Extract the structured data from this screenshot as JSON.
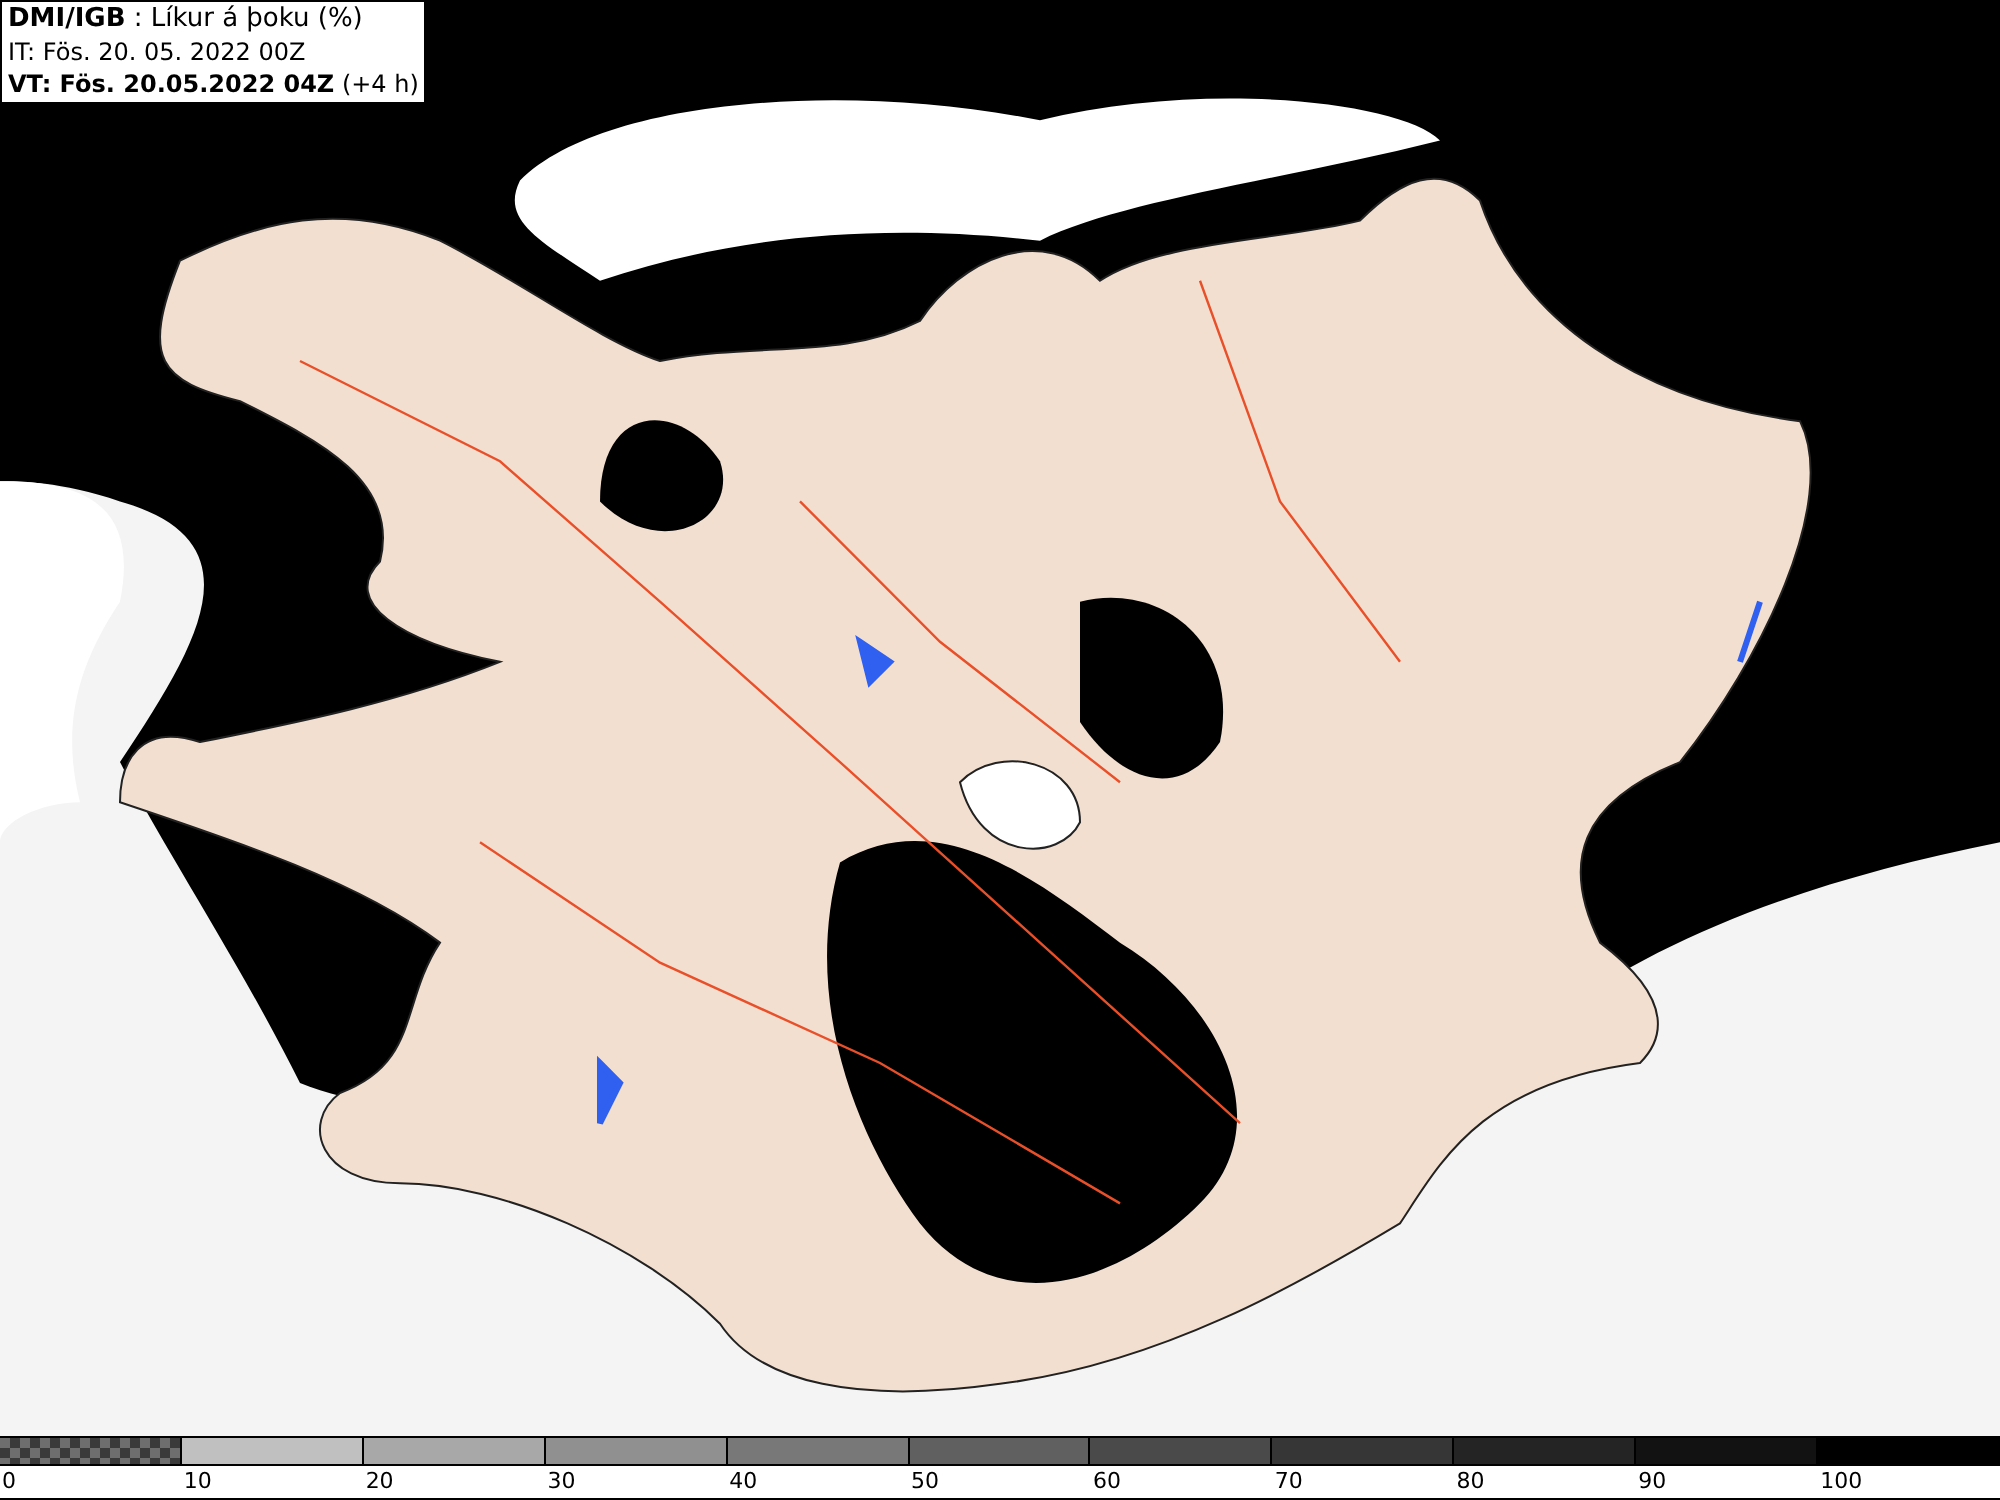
{
  "header": {
    "title": "**DMI/IGB** : Líkur á þoku (%)",
    "issue_time": "IT: Fös. 20. 05. 2022 00Z",
    "valid_time": "**VT: Fös. 20.05.2022 04Z** (+4 h)"
  },
  "legend": [
    {
      "label": "0",
      "kind": "pattern"
    },
    {
      "label": "10",
      "kind": "solid",
      "color": "#c0c0c0"
    },
    {
      "label": "20",
      "kind": "solid",
      "color": "#a8a8a8"
    },
    {
      "label": "30",
      "kind": "solid",
      "color": "#909090"
    },
    {
      "label": "40",
      "kind": "solid",
      "color": "#787878"
    },
    {
      "label": "50",
      "kind": "solid",
      "color": "#606060"
    },
    {
      "label": "60",
      "kind": "solid",
      "color": "#4a4a4a"
    },
    {
      "label": "70",
      "kind": "solid",
      "color": "#363636"
    },
    {
      "label": "80",
      "kind": "solid",
      "color": "#242424"
    },
    {
      "label": "90",
      "kind": "solid",
      "color": "#121212"
    },
    {
      "label": "100",
      "kind": "solid",
      "color": "#000000"
    }
  ]
}
